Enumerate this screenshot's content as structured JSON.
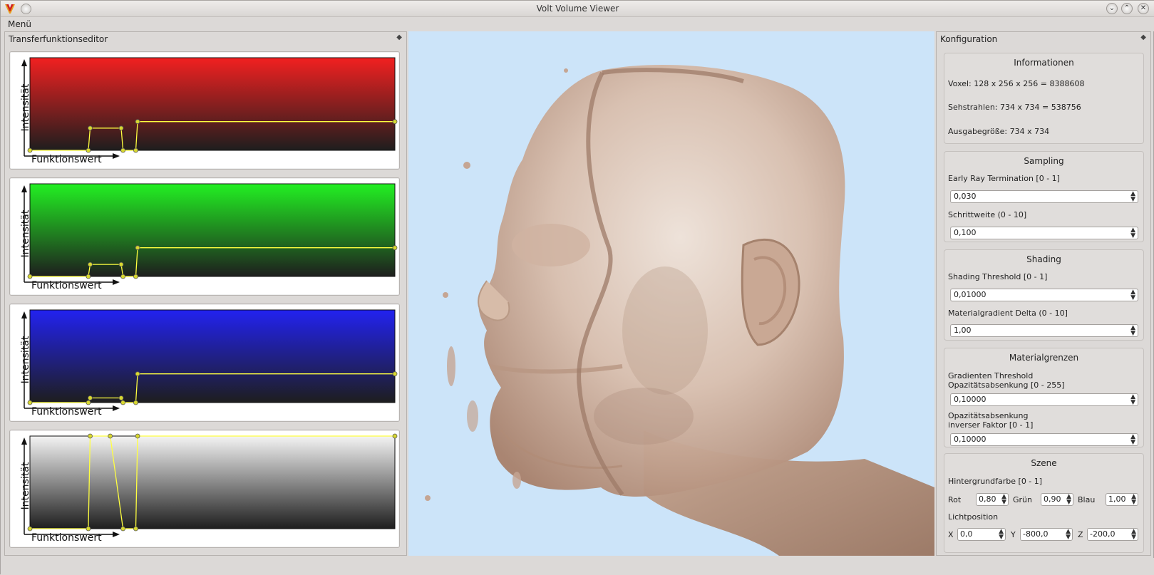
{
  "window": {
    "title": "Volt Volume Viewer",
    "minimize_icon": "chevron-down-icon",
    "maximize_icon": "chevron-up-icon",
    "close_icon": "close-icon"
  },
  "menu": {
    "label": "Menü"
  },
  "tf_editor": {
    "dock_title": "Transferfunktionseditor",
    "y_label": "Intensität",
    "x_label": "Funktionswert",
    "channels": [
      {
        "name": "red",
        "top_color": "#f22020",
        "bottom_color": "#1e1e1e",
        "points": [
          [
            0,
            0
          ],
          [
            0.16,
            0
          ],
          [
            0.165,
            0.24
          ],
          [
            0.25,
            0.24
          ],
          [
            0.255,
            0
          ],
          [
            0.29,
            0
          ],
          [
            0.295,
            0.31
          ],
          [
            1,
            0.31
          ]
        ]
      },
      {
        "name": "green",
        "top_color": "#22f022",
        "bottom_color": "#1e1e1e",
        "points": [
          [
            0,
            0
          ],
          [
            0.16,
            0
          ],
          [
            0.165,
            0.13
          ],
          [
            0.25,
            0.13
          ],
          [
            0.255,
            0
          ],
          [
            0.29,
            0
          ],
          [
            0.295,
            0.31
          ],
          [
            1,
            0.31
          ]
        ]
      },
      {
        "name": "blue",
        "top_color": "#2222f0",
        "bottom_color": "#1e1e1e",
        "points": [
          [
            0,
            0
          ],
          [
            0.16,
            0
          ],
          [
            0.165,
            0.05
          ],
          [
            0.25,
            0.05
          ],
          [
            0.255,
            0
          ],
          [
            0.29,
            0
          ],
          [
            0.295,
            0.31
          ],
          [
            1,
            0.31
          ]
        ]
      },
      {
        "name": "alpha",
        "top_color": "#f4f4f4",
        "bottom_color": "#1e1e1e",
        "points": [
          [
            0,
            0
          ],
          [
            0.16,
            0
          ],
          [
            0.165,
            1
          ],
          [
            0.22,
            1
          ],
          [
            0.255,
            0
          ],
          [
            0.29,
            0
          ],
          [
            0.295,
            1
          ],
          [
            1,
            1
          ]
        ]
      }
    ]
  },
  "config": {
    "dock_title": "Konfiguration",
    "info": {
      "title": "Informationen",
      "voxel": "Voxel: 128 x 256 x 256 = 8388608",
      "rays": "Sehstrahlen: 734 x 734 = 538756",
      "output": "Ausgabegröße: 734 x 734"
    },
    "sampling": {
      "title": "Sampling",
      "ert_label": "Early Ray Termination [0 - 1]",
      "ert_value": "0,030",
      "step_label": "Schrittweite (0 - 10]",
      "step_value": "0,100"
    },
    "shading": {
      "title": "Shading",
      "threshold_label": "Shading Threshold [0 - 1]",
      "threshold_value": "0,01000",
      "delta_label": "Materialgradient Delta (0 - 10]",
      "delta_value": "1,00"
    },
    "material": {
      "title": "Materialgrenzen",
      "grad_label_1": "Gradienten Threshold",
      "grad_label_2": "Opazitätsabsenkung [0 - 255]",
      "grad_value": "0,10000",
      "inv_label_1": "Opazitätsabsenkung",
      "inv_label_2": "inverser Faktor [0 - 1]",
      "inv_value": "0,10000"
    },
    "scene": {
      "title": "Szene",
      "bg_label": "Hintergrundfarbe [0 - 1]",
      "red_label": "Rot",
      "red_value": "0,80",
      "green_label": "Grün",
      "green_value": "0,90",
      "blue_label": "Blau",
      "blue_value": "1,00",
      "light_label": "Lichtposition",
      "x_label": "X",
      "x_value": "0,0",
      "y_label": "Y",
      "y_value": "-800,0",
      "z_label": "Z",
      "z_value": "-200,0"
    }
  }
}
